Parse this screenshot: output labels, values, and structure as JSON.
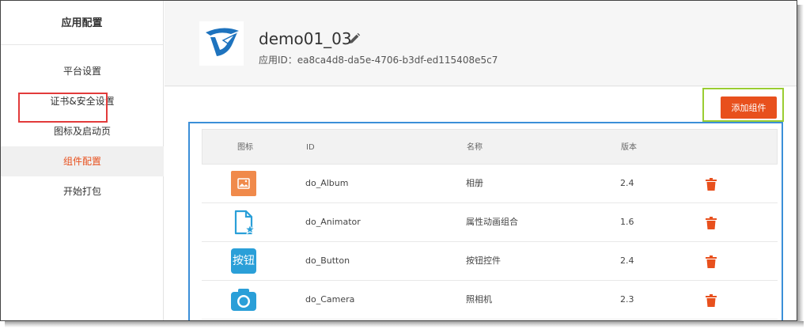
{
  "sidebar": {
    "title": "应用配置",
    "items": [
      {
        "label": "平台设置"
      },
      {
        "label": "证书&安全设置"
      },
      {
        "label": "图标及启动页"
      },
      {
        "label": "组件配置"
      },
      {
        "label": "开始打包"
      }
    ],
    "active_index": 3
  },
  "app": {
    "name": "demo01_03",
    "id_label": "应用ID：",
    "id_value": "ea8ca4d8-da5e-4706-b3df-ed115408e5c7"
  },
  "toolbar": {
    "add_label": "添加组件"
  },
  "table": {
    "headers": {
      "icon": "图标",
      "id": "ID",
      "name": "名称",
      "version": "版本"
    },
    "rows": [
      {
        "icon": "album-icon",
        "id": "do_Album",
        "name": "相册",
        "version": "2.4"
      },
      {
        "icon": "animator-icon",
        "id": "do_Animator",
        "name": "属性动画组合",
        "version": "1.6"
      },
      {
        "icon": "button-icon",
        "id": "do_Button",
        "name": "按钮控件",
        "version": "2.4",
        "icon_text": "按钮"
      },
      {
        "icon": "camera-icon",
        "id": "do_Camera",
        "name": "照相机",
        "version": "2.3"
      }
    ]
  },
  "colors": {
    "accent": "#e8501d",
    "icon_orange": "#f08a4b",
    "icon_blue": "#2a9fd8",
    "highlight_red": "#e23b3b",
    "highlight_green": "#9acd32",
    "highlight_blue": "#3b8fd8"
  }
}
